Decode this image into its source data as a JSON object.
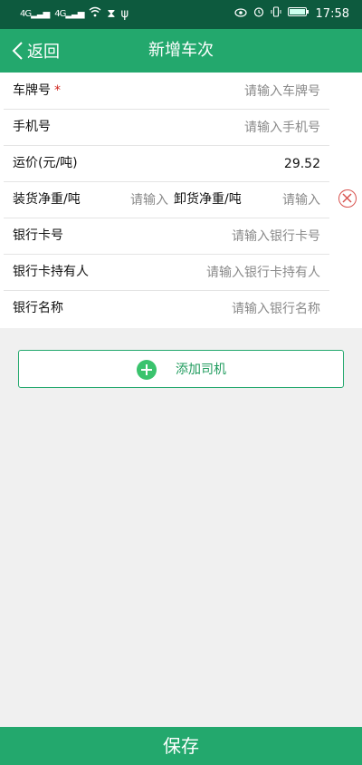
{
  "status": {
    "sim1": "4G",
    "sim2": "4G",
    "time": "17:58",
    "icons": [
      "signal-icon",
      "signal-icon",
      "wifi-icon",
      "hourglass-icon",
      "usb-icon",
      "eye-icon",
      "alarm-icon",
      "vibrate-icon",
      "battery-icon"
    ]
  },
  "header": {
    "back_label": "返回",
    "title": "新增车次"
  },
  "form": {
    "plate": {
      "label": "车牌号",
      "required_mark": "*",
      "placeholder": "请输入车牌号",
      "value": ""
    },
    "phone": {
      "label": "手机号",
      "placeholder": "请输入手机号",
      "value": ""
    },
    "freight": {
      "label": "运价(元/吨)",
      "value": "29.52"
    },
    "load": {
      "label": "装货净重/吨",
      "placeholder": "请输入",
      "value": ""
    },
    "unload": {
      "label": "卸货净重/吨",
      "placeholder": "请输入",
      "value": ""
    },
    "bank_card": {
      "label": "银行卡号",
      "placeholder": "请输入银行卡号",
      "value": ""
    },
    "card_holder": {
      "label": "银行卡持有人",
      "placeholder": "请输入银行卡持有人",
      "value": ""
    },
    "bank_name": {
      "label": "银行名称",
      "placeholder": "请输入银行名称",
      "value": ""
    }
  },
  "actions": {
    "add_driver": "添加司机",
    "save": "保存"
  },
  "colors": {
    "status_bar": "#0d5a3e",
    "primary": "#23a86d",
    "accent_green": "#3ac36d",
    "required": "#d0261f",
    "delete": "#d8534f"
  }
}
